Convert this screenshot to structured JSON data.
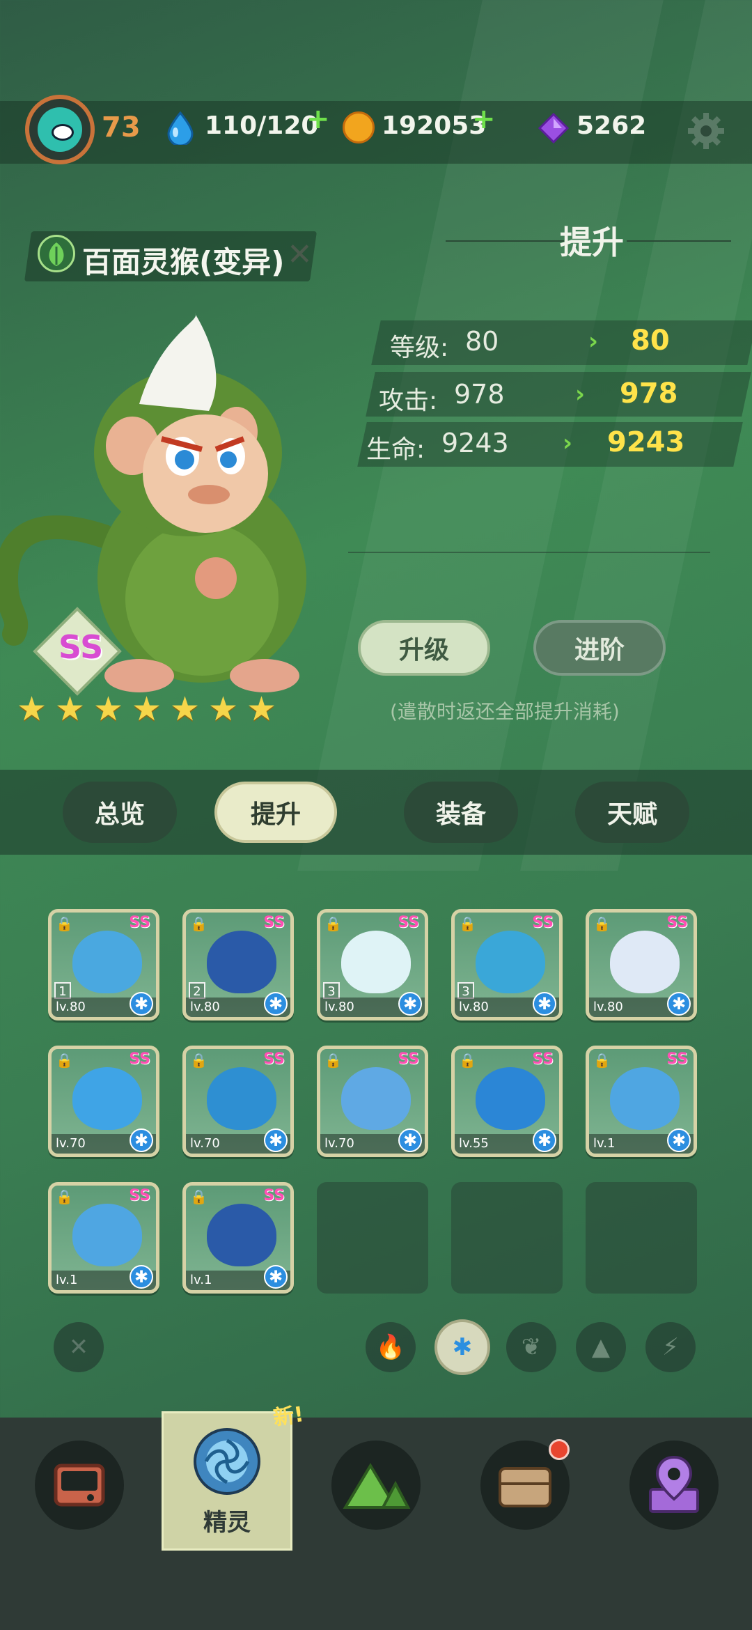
{
  "header": {
    "player_level": "73",
    "energy": "110/120",
    "coins": "192053",
    "gems": "5262"
  },
  "pet": {
    "name": "百面灵猴(变异)",
    "rank": "SS",
    "stars": [
      "★",
      "★",
      "★",
      "★",
      "★",
      "★",
      "★"
    ]
  },
  "upgrade": {
    "title": "提升",
    "stats": [
      {
        "label": "等级:",
        "current": "80",
        "next": "80"
      },
      {
        "label": "攻击:",
        "current": "978",
        "next": "978"
      },
      {
        "label": "生命:",
        "current": "9243",
        "next": "9243"
      }
    ],
    "level_up_button": "升级",
    "advance_button": "进阶",
    "hint": "(遣散时返还全部提升消耗)"
  },
  "tabs": [
    "总览",
    "提升",
    "装备",
    "天赋"
  ],
  "pets_grid": [
    {
      "ss": "SS",
      "level": "lv.80",
      "slot": "1",
      "color": "#4aa8e0"
    },
    {
      "ss": "SS",
      "level": "lv.80",
      "slot": "2",
      "color": "#2a5aa8"
    },
    {
      "ss": "SS",
      "level": "lv.80",
      "slot": "3",
      "color": "#dff3f6"
    },
    {
      "ss": "SS",
      "level": "lv.80",
      "slot": "3",
      "color": "#3aa7d8"
    },
    {
      "ss": "SS",
      "level": "lv.80",
      "slot": "",
      "color": "#dfe9f6"
    },
    {
      "ss": "SS",
      "level": "lv.70",
      "slot": "",
      "color": "#3fa4e6"
    },
    {
      "ss": "SS",
      "level": "lv.70",
      "slot": "",
      "color": "#2e8fd2"
    },
    {
      "ss": "SS",
      "level": "lv.70",
      "slot": "",
      "color": "#5fa9e4"
    },
    {
      "ss": "SS",
      "level": "lv.55",
      "slot": "",
      "color": "#2b86d6"
    },
    {
      "ss": "SS",
      "level": "lv.1",
      "slot": "",
      "color": "#4fa6e2"
    },
    {
      "ss": "SS",
      "level": "lv.1",
      "slot": "",
      "color": "#4fa6e2"
    },
    {
      "ss": "SS",
      "level": "lv.1",
      "slot": "",
      "color": "#2a5aa8"
    }
  ],
  "filters": {
    "clear": "✕",
    "fire": "🔥",
    "ice": "✱",
    "leaf": "❦",
    "rock": "▲",
    "thunder": "⚡"
  },
  "nav": {
    "spirit_label": "精灵",
    "new_badge": "新!"
  }
}
